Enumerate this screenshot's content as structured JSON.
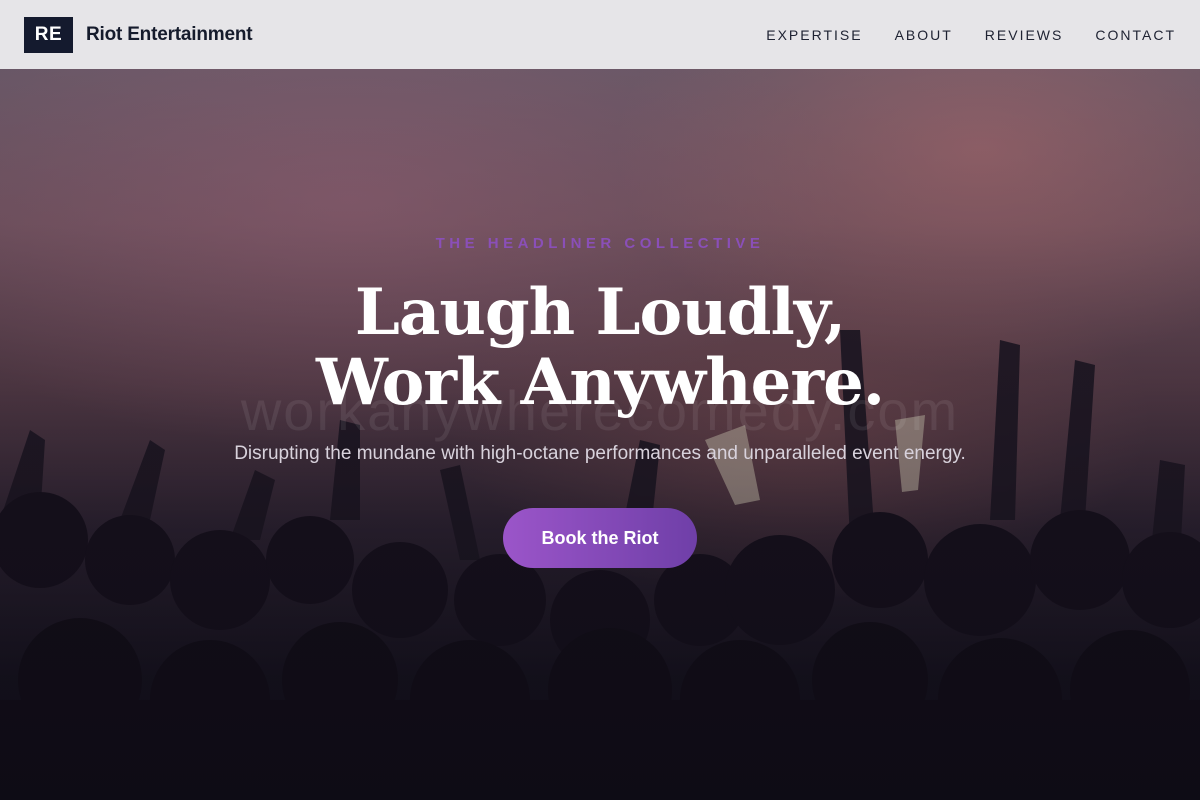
{
  "header": {
    "logo_initials": "RE",
    "brand_name": "Riot Entertainment",
    "nav": [
      {
        "label": "EXPERTISE"
      },
      {
        "label": "ABOUT"
      },
      {
        "label": "REVIEWS"
      },
      {
        "label": "CONTACT"
      }
    ]
  },
  "hero": {
    "eyebrow": "THE HEADLINER COLLECTIVE",
    "headline_line1": "Laugh Loudly,",
    "headline_line2": "Work Anywhere.",
    "watermark": "workanywherecomedy.com",
    "subtitle": "Disrupting the mundane with high-octane performances and unparalleled event energy.",
    "cta_label": "Book the Riot"
  },
  "colors": {
    "accent": "#8a4fb8",
    "cta_start": "#9b55c9",
    "cta_end": "#6f3fa8",
    "logo_bg": "#141a2e",
    "navbar_bg": "#e6e5e8"
  }
}
